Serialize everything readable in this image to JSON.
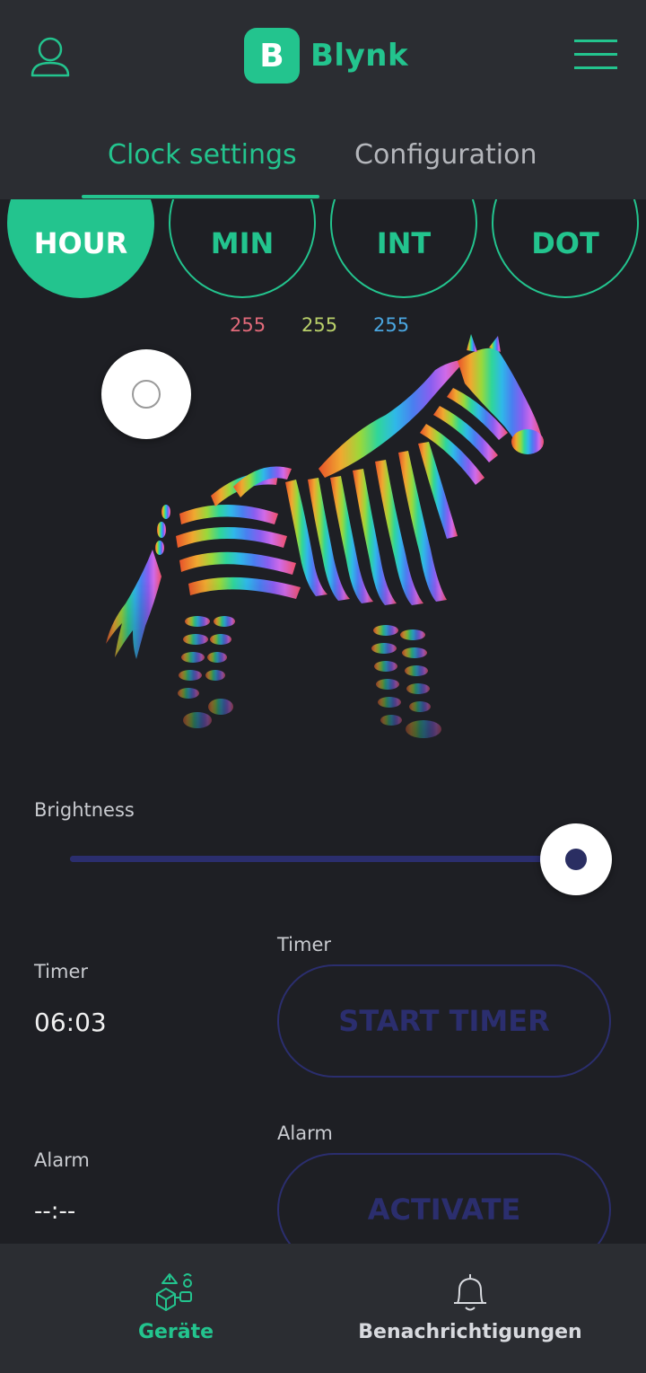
{
  "header": {
    "logo_letter": "B",
    "app_name": "Blynk",
    "user_icon": "user-icon",
    "menu_icon": "hamburger-menu-icon"
  },
  "tabs": [
    {
      "label": "Clock settings",
      "active": true
    },
    {
      "label": "Configuration",
      "active": false
    }
  ],
  "segments": [
    {
      "label": "HOUR",
      "active": true
    },
    {
      "label": "MIN",
      "active": false
    },
    {
      "label": "INT",
      "active": false
    },
    {
      "label": "DOT",
      "active": false
    }
  ],
  "rgb": {
    "r": "255",
    "g": "255",
    "b": "255"
  },
  "brightness": {
    "label": "Brightness",
    "value_fraction": 1.0
  },
  "timer": {
    "label": "Timer",
    "value": "06:03",
    "button_label": "Timer",
    "button_text": "START TIMER"
  },
  "alarm": {
    "label": "Alarm",
    "value": "--:--",
    "button_label": "Alarm",
    "button_text": "ACTIVATE"
  },
  "bottom_nav": [
    {
      "label": "Geräte",
      "icon": "devices-icon",
      "active": true
    },
    {
      "label": "Benachrichtigungen",
      "icon": "bell-icon",
      "active": false
    }
  ],
  "colors": {
    "accent": "#23c48e",
    "background": "#1e1f24",
    "header": "#2b2d32",
    "inactive_button": "#2b2e6e"
  }
}
